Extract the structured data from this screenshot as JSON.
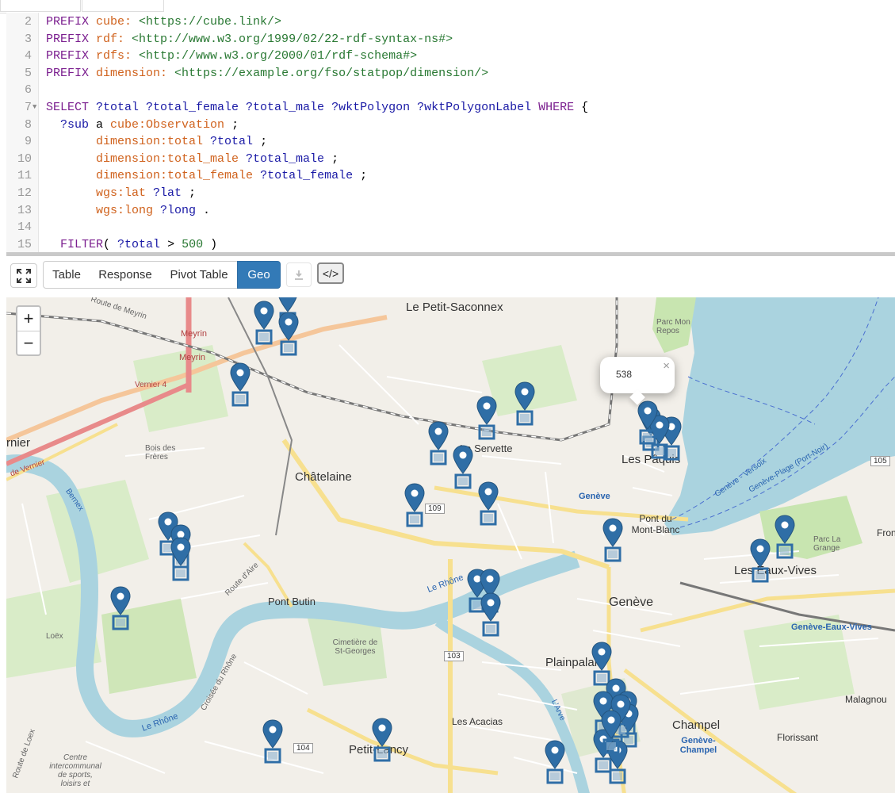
{
  "editor": {
    "lines": [
      {
        "n": "2",
        "parts": [
          [
            "kw",
            "PREFIX "
          ],
          [
            "pfx",
            "cube: "
          ],
          [
            "iri",
            "<https://cube.link/>"
          ]
        ]
      },
      {
        "n": "3",
        "parts": [
          [
            "kw",
            "PREFIX "
          ],
          [
            "pfx",
            "rdf: "
          ],
          [
            "iri",
            "<http://www.w3.org/1999/02/22-rdf-syntax-ns#>"
          ]
        ]
      },
      {
        "n": "4",
        "parts": [
          [
            "kw",
            "PREFIX "
          ],
          [
            "pfx",
            "rdfs: "
          ],
          [
            "iri",
            "<http://www.w3.org/2000/01/rdf-schema#>"
          ]
        ]
      },
      {
        "n": "5",
        "parts": [
          [
            "kw",
            "PREFIX "
          ],
          [
            "pfx",
            "dimension: "
          ],
          [
            "iri",
            "<https://example.org/fso/statpop/dimension/>"
          ]
        ]
      },
      {
        "n": "6",
        "parts": []
      },
      {
        "n": "7",
        "fold": true,
        "parts": [
          [
            "kw",
            "SELECT "
          ],
          [
            "var",
            "?total ?total_female ?total_male ?wktPolygon ?wktPolygonLabel "
          ],
          [
            "kw",
            "WHERE "
          ],
          [
            "pn",
            "{"
          ]
        ]
      },
      {
        "n": "8",
        "parts": [
          [
            "var",
            "  ?sub "
          ],
          [
            "pn",
            "a "
          ],
          [
            "pfx",
            "cube:Observation "
          ],
          [
            "pn",
            ";"
          ]
        ]
      },
      {
        "n": "9",
        "parts": [
          [
            "pn",
            "       "
          ],
          [
            "pfx",
            "dimension:total "
          ],
          [
            "var",
            "?total "
          ],
          [
            "pn",
            ";"
          ]
        ]
      },
      {
        "n": "10",
        "parts": [
          [
            "pn",
            "       "
          ],
          [
            "pfx",
            "dimension:total_male "
          ],
          [
            "var",
            "?total_male "
          ],
          [
            "pn",
            ";"
          ]
        ]
      },
      {
        "n": "11",
        "parts": [
          [
            "pn",
            "       "
          ],
          [
            "pfx",
            "dimension:total_female "
          ],
          [
            "var",
            "?total_female "
          ],
          [
            "pn",
            ";"
          ]
        ]
      },
      {
        "n": "12",
        "parts": [
          [
            "pn",
            "       "
          ],
          [
            "pfx",
            "wgs:lat "
          ],
          [
            "var",
            "?lat "
          ],
          [
            "pn",
            ";"
          ]
        ]
      },
      {
        "n": "13",
        "parts": [
          [
            "pn",
            "       "
          ],
          [
            "pfx",
            "wgs:long "
          ],
          [
            "var",
            "?long "
          ],
          [
            "pn",
            "."
          ]
        ]
      },
      {
        "n": "14",
        "parts": []
      },
      {
        "n": "15",
        "parts": [
          [
            "pn",
            "  "
          ],
          [
            "kw",
            "FILTER"
          ],
          [
            "pn",
            "( "
          ],
          [
            "var",
            "?total "
          ],
          [
            "pn",
            "> "
          ],
          [
            "num",
            "500 "
          ],
          [
            "pn",
            ")"
          ]
        ]
      }
    ]
  },
  "toolbar": {
    "fullscreen_icon": "expand-icon",
    "tabs": [
      "Table",
      "Response",
      "Pivot Table",
      "Geo"
    ],
    "active_tab": "Geo",
    "download_icon": "download-icon",
    "code_label": "</>"
  },
  "colors": {
    "active_tab": "#337ab7",
    "marker": "#2f6ea6"
  },
  "map": {
    "zoom_in": "+",
    "zoom_out": "−",
    "popup": {
      "text": "538",
      "close": "×"
    },
    "labels": {
      "le_petit_saconnex": "Le Petit-Saconnex",
      "meyrin": "Meyrin",
      "meyrin2": "Meyrin",
      "route_meyrin": "Route de Meyrin",
      "vernier_road": "Vernier 4",
      "bois_freres": "Bois des Frères",
      "vernier": "rnier",
      "route_vernier": "de Vernier",
      "bernex": "Bernex",
      "chatelaine": "Châtelaine",
      "la_servette": "La Servette",
      "les_paquis": "Les Pâquis",
      "geneve_station": "Genève",
      "pont_mont_blanc": "Pont du Mont-Blanc",
      "geneve": "Genève",
      "eaux_vives": "Les Eaux-Vives",
      "parc_la_grange": "Parc La Grange",
      "geneve_eaux_vives": "Genève-Eaux-Vives",
      "pont_butin": "Pont Butin",
      "loex": "Loëx",
      "cimetiere": "Cimetière de St-Georges",
      "le_rhone": "Le Rhône",
      "le_rhone2": "Le Rhône",
      "plainpalais": "Plainpalais",
      "les_acacias": "Les Acacias",
      "petit_lancy": "Petit-Lancy",
      "champel": "Champel",
      "geneve_champel": "Genève-Champel",
      "malagnou": "Malagnou",
      "florissant": "Florissant",
      "fron": "Fron",
      "centre": "Centre intercommunal de sports, loisirs et",
      "parc_mon_repos": "Parc Mon Repos",
      "route_loex": "Route de Loex",
      "route_aire": "Route d'Aire",
      "croisee": "Croisée du Rhône",
      "l_arve": "L'Arve",
      "geneve_versoix": "Genève - Versoix",
      "geneve_plage": "Genève-Plage (Port-Noir)"
    },
    "shields": {
      "r109": "109",
      "r103": "103",
      "r104": "104",
      "r105": "105"
    },
    "marker_count": 40
  }
}
